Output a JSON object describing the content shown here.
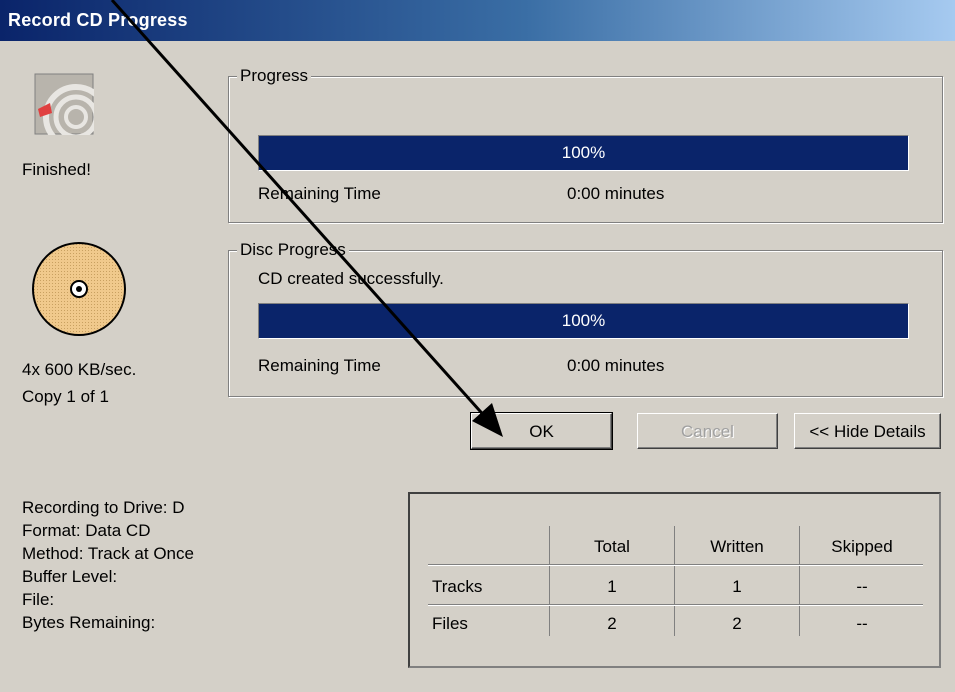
{
  "window": {
    "title": "Record CD Progress"
  },
  "status": {
    "message": "Finished!",
    "speed": "4x 600 KB/sec.",
    "copy": "Copy 1 of 1"
  },
  "progress_group": {
    "label": "Progress",
    "percent_text": "100%",
    "percent_value": 100,
    "remaining_label": "Remaining Time",
    "remaining_value": "0:00 minutes"
  },
  "disc_group": {
    "label": "Disc Progress",
    "status_text": "CD created successfully.",
    "percent_text": "100%",
    "percent_value": 100,
    "remaining_label": "Remaining Time",
    "remaining_value": "0:00 minutes"
  },
  "buttons": {
    "ok": "OK",
    "cancel": "Cancel",
    "hide_details": "<< Hide Details"
  },
  "details": {
    "drive": "Recording to Drive: D",
    "format": "Format: Data CD",
    "method": "Method: Track at Once",
    "buffer": "Buffer Level:",
    "file": "File:",
    "bytes": "Bytes Remaining:"
  },
  "stats_table": {
    "headers": [
      "",
      "Total",
      "Written",
      "Skipped"
    ],
    "rows": [
      [
        "Tracks",
        "1",
        "1",
        "--"
      ],
      [
        "Files",
        "2",
        "2",
        "--"
      ]
    ]
  },
  "colors": {
    "progress_fill": "#0a246a",
    "disc_fill": "#f0c98c",
    "annotation_arrow": "#000000"
  },
  "icons": [
    "cd-burner-icon",
    "disc-icon",
    "annotation-arrow"
  ]
}
